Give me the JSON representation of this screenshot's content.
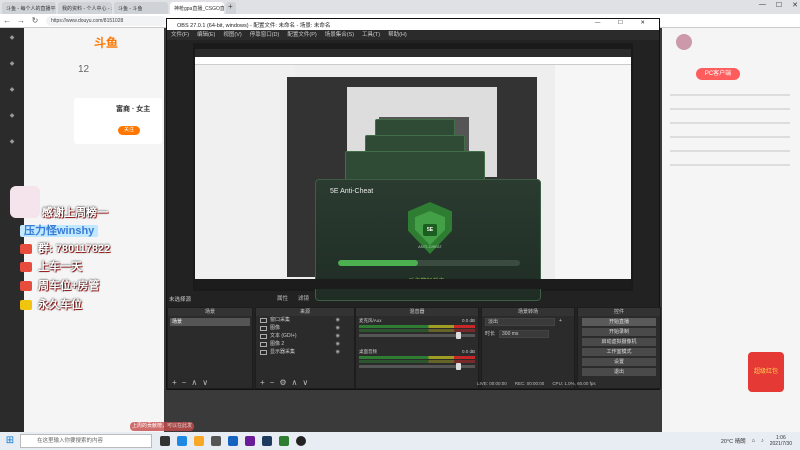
{
  "browser": {
    "tabs": [
      "斗鱼 - 每个人的直播平台",
      "我的资料 - 个人中心 - 斗鱼",
      "斗鱼 - 斗鱼",
      "神枪gpa直播_CSGO直播_斗鱼直播"
    ],
    "url": "https://www.douyu.com/8151028"
  },
  "douyu": {
    "logo": "斗鱼",
    "stat": "12",
    "anchor_name": "富商 · 女主",
    "follow_label": "关注",
    "right_pill": "PC客户端",
    "gift_label": "超级红包"
  },
  "overlay": {
    "line1": "感谢上周榜一",
    "line2": "压力怪winshy",
    "line3": "群: 780117822",
    "line4": "上车一天",
    "line5": "周车位+房管",
    "line6": "永久车位",
    "bottom_hint": "上周的贡献榜，可以在此发"
  },
  "obs": {
    "title": "OBS 27.0.1 (64-bit, windows) - 配置文件: 未命名 - 场景: 未命名",
    "menu": [
      "文件(F)",
      "编辑(E)",
      "视图(V)",
      "停靠窗口(D)",
      "配置文件(P)",
      "场景集合(S)",
      "工具(T)",
      "帮助(H)"
    ],
    "scene_label": "未选择源",
    "preview_ctrls": [
      "属性",
      "滤镜"
    ],
    "anticheat": {
      "title": "5E Anti-Cheat",
      "shield_text": "ANTI-CHEAT",
      "status": "反作弊加载中...",
      "progress": 0.44
    },
    "docks": {
      "scenes_title": "场景",
      "sources_title": "来源",
      "mixer_title": "混音器",
      "trans_title": "场景转场",
      "ctrl_title": "控件"
    },
    "scenes": [
      "场景"
    ],
    "sources": [
      "窗口采集",
      "图像",
      "文本 (GDI+)",
      "图像 2",
      "显示器采集"
    ],
    "mixer": [
      {
        "name": "麦克风/Aux",
        "db": "0.0 dB"
      },
      {
        "name": "桌面音频",
        "db": "0.0 dB"
      }
    ],
    "transition": {
      "type": "淡出",
      "duration_label": "时长",
      "duration": "300 ms"
    },
    "controls": [
      "开始直播",
      "开始录制",
      "启动虚拟摄像机",
      "工作室模式",
      "设置",
      "退出"
    ],
    "statusbar": [
      "LIVE: 00:00:00",
      "REC: 00:00:00",
      "CPU: 1.0%, 60.00 fps"
    ]
  },
  "taskbar": {
    "search_placeholder": "在这里输入你要搜索的内容",
    "weather": "20°C 晴朗",
    "time": "1:06",
    "date": "2021/7/30"
  }
}
